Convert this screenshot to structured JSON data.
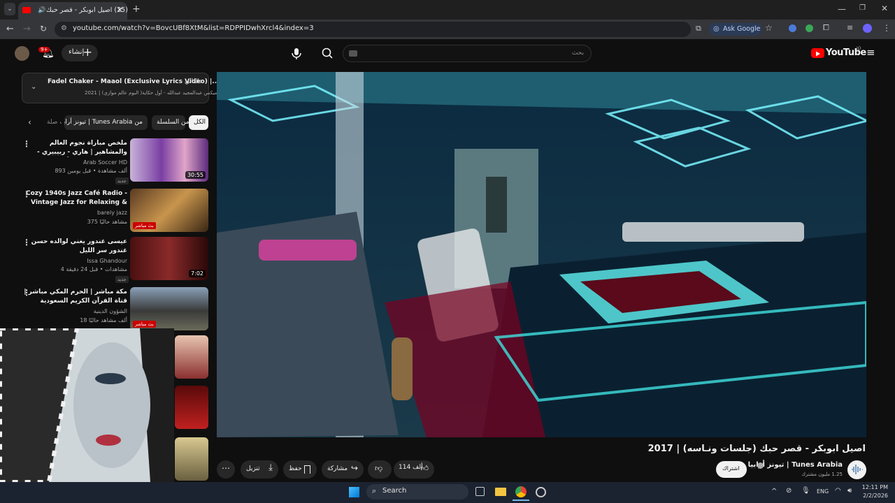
{
  "browser": {
    "tab_title": "(25) اصيل ابوبكر - قصر حبك",
    "url": "youtube.com/watch?v=BovcUBf8XtM&list=RDPPIDwhXrcl4&index=3",
    "ask_google": "Ask Google"
  },
  "youtube": {
    "logo": "YouTube",
    "logo_region": "JO",
    "search_placeholder": "بحث",
    "create_label": "إنشاء",
    "notif_count": "9+"
  },
  "next_card": {
    "label": "التالي:",
    "title": "Fadel Chaker - Maaol (Exclusive Lyrics Video) |...",
    "subtitle": "ميكس عبدالمجيد عبدالله - أول حكاية( البوم عالم موازي) | 2021"
  },
  "chips": [
    "الكل",
    "من السلسلة",
    "من Tunes Arabia | تيونز أرابيا",
    "ذات صلة"
  ],
  "videos": [
    {
      "title": "ملخص مباراة نجوم العالم والمشاهير | هاري - ربيبيري - مستر بيست - أبو فله - دليو - ...",
      "channel": "Arab Soccer HD",
      "meta": "893 ألف مشاهدة • قبل يومين",
      "duration": "30:55",
      "badge": "جديد",
      "live": ""
    },
    {
      "title": "Cozy 1940s Jazz Café Radio - Vintage Jazz for Relaxing & ...",
      "channel": "barely jazz",
      "meta": "375 مشاهد حاليًا",
      "duration": "",
      "badge": "",
      "live": "بث مباشر"
    },
    {
      "title": "عيسى غندور يغني لوالده حسن غندور سر الليل",
      "channel": "Issa Ghandour",
      "meta": "4 مشاهدات • قبل 24 دقيقة",
      "duration": "7:02",
      "badge": "جديد",
      "live": ""
    },
    {
      "title": "مكة مباشر | الحرم المكي مباشر | قناة القرآن الكريم السعودية Makkah Live |",
      "channel": "الشؤون الدينية",
      "meta": "18 ألف مشاهد حاليًا",
      "duration": "",
      "badge": "",
      "live": "بث مباشر"
    }
  ],
  "video": {
    "title": "اصيل ابوبكر - قصر حبك (جلسات ونـاسه) | 2017",
    "channel": "Tunes Arabia | تيونز أرابيا",
    "subscribers": "1.25 مليون مشترك",
    "subscribe": "اشتراك",
    "likes": "114 ألف",
    "share": "مشاركة",
    "save": "حفظ",
    "download": "تنزيل"
  },
  "taskbar": {
    "search": "Search",
    "lang": "ENG",
    "time": "12:11 PM",
    "date": "2/2/2026"
  },
  "colors": {
    "accent": "#ff0000",
    "live": "#cc0000",
    "bg": "#0f0f0f"
  }
}
